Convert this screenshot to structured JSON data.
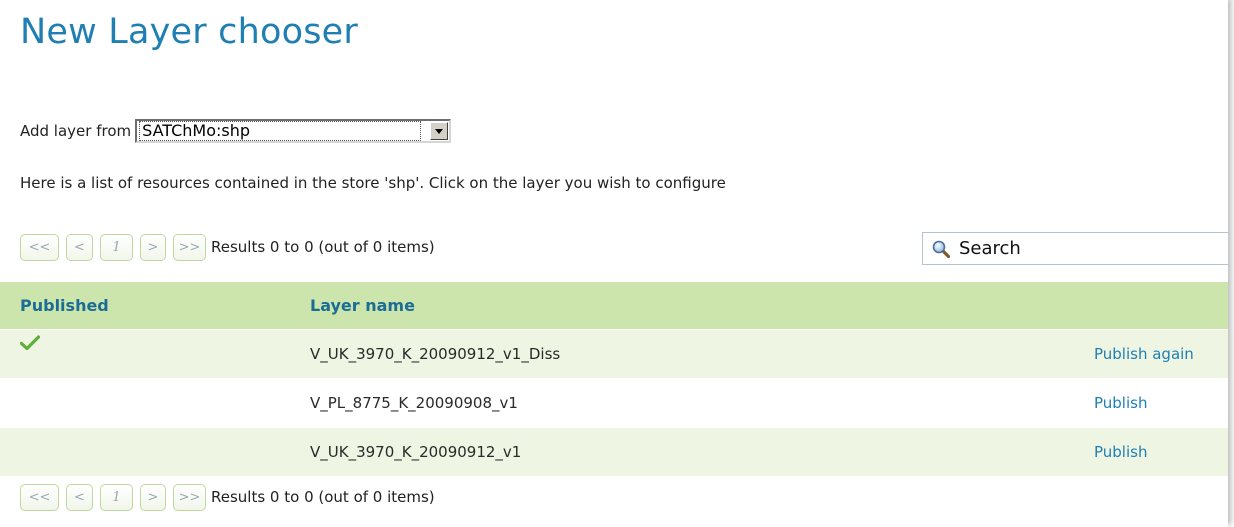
{
  "page": {
    "title": "New Layer chooser"
  },
  "add_layer": {
    "label": "Add layer from",
    "selected": "SATChMo:shp"
  },
  "description": "Here is a list of resources contained in the store 'shp'. Click on the layer you wish to configure",
  "pager": {
    "first": "<<",
    "prev": "<",
    "page": "1",
    "next": ">",
    "last": ">>",
    "results": "Results 0 to 0 (out of 0 items)"
  },
  "search": {
    "placeholder": "Search",
    "icon": "magnifier-icon"
  },
  "table": {
    "headers": [
      "Published",
      "Layer name",
      ""
    ],
    "rows": [
      {
        "published": true,
        "name": "V_UK_3970_K_20090912_v1_Diss",
        "action": "Publish again"
      },
      {
        "published": false,
        "name": "V_PL_8775_K_20090908_v1",
        "action": "Publish"
      },
      {
        "published": false,
        "name": "V_UK_3970_K_20090912_v1",
        "action": "Publish"
      }
    ]
  },
  "colors": {
    "title": "#1f7fb3",
    "header_bg": "#cce5ad",
    "header_text": "#1c6d96",
    "row_alt_bg": "#eef5e3",
    "link": "#1f7fb3",
    "check": "#5fae3c"
  }
}
